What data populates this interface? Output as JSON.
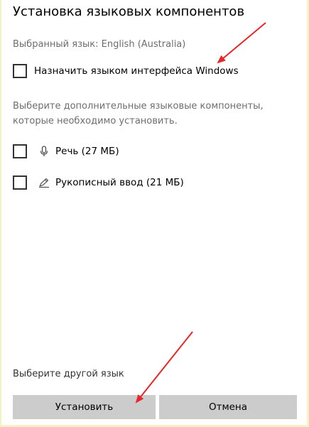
{
  "dialog": {
    "title": "Установка языковых компонентов",
    "selected_language": "Выбранный язык: English (Australia)",
    "display_language_option": {
      "label": "Назначить языком интерфейса Windows",
      "checked": false
    },
    "instructions": "Выберите дополнительные языковые компоненты, которые необходимо установить.",
    "features": [
      {
        "label": "Речь (27 МБ)",
        "icon": "microphone-icon",
        "checked": false
      },
      {
        "label": "Рукописный ввод (21 МБ)",
        "icon": "handwriting-pen-icon",
        "checked": false
      }
    ],
    "other_language_link": "Выберите другой язык",
    "install_button": "Установить",
    "cancel_button": "Отмена"
  },
  "colors": {
    "page_background": "#f5f3c6",
    "dialog_background": "#ffffff",
    "secondary_text": "#6d6d6d",
    "button_background": "#cccccc",
    "annotation_arrow": "#e8262a"
  }
}
